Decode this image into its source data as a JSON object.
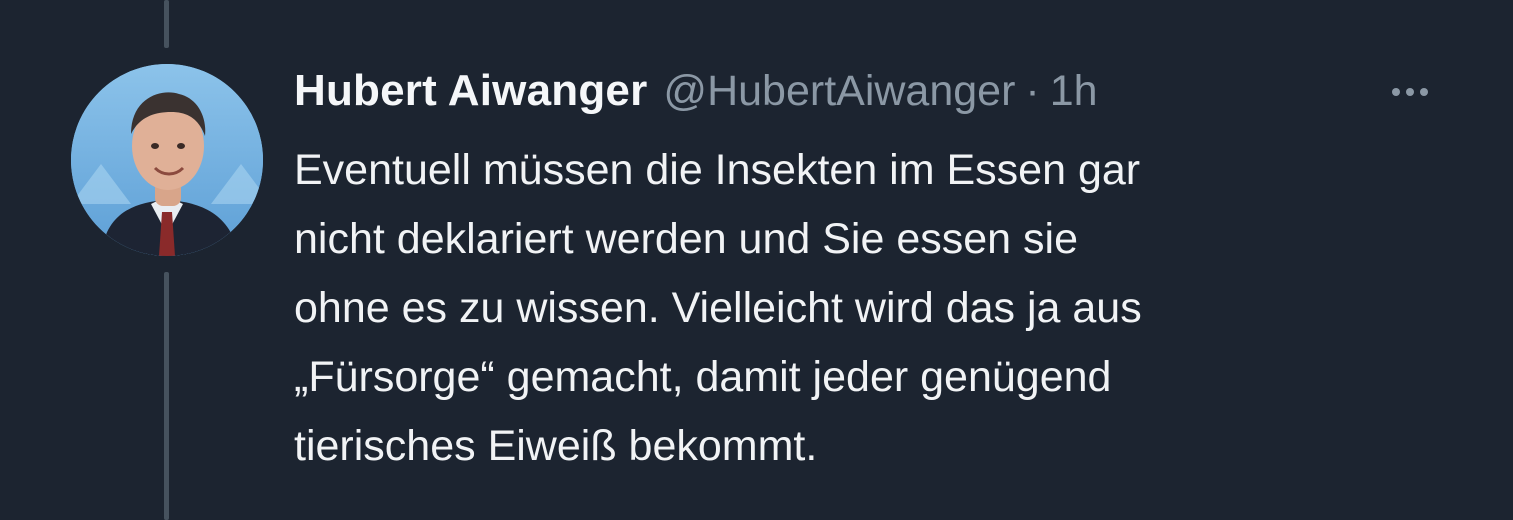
{
  "tweet": {
    "author": {
      "display_name": "Hubert Aiwanger",
      "handle": "@HubertAiwanger",
      "avatar_icon": "profile-photo"
    },
    "separator": "·",
    "time": "1h",
    "text_lines": [
      "Eventuell müssen die Insekten im Essen gar",
      "nicht deklariert werden und Sie essen sie",
      "ohne es zu wissen. Vielleicht wird das ja aus",
      "„Fürsorge“ gemacht, damit jeder genügend",
      "tierisches Eiweiß bekommt."
    ],
    "more_icon": "more-horizontal-icon"
  },
  "colors": {
    "background": "#1c2430",
    "primary_text": "#f1f3f5",
    "secondary_text": "#8b98a5",
    "thread_line": "#46525e"
  }
}
